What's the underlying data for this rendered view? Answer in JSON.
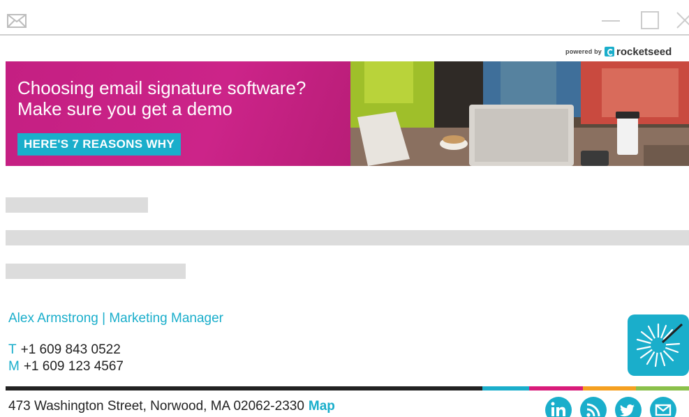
{
  "window": {
    "icons": [
      "mail-icon",
      "minimize-icon",
      "maximize-icon",
      "close-icon"
    ]
  },
  "powered_by": {
    "prefix": "powered by",
    "brand": "rocketseed"
  },
  "banner": {
    "headline_line1": "Choosing email signature software?",
    "headline_line2": "Make sure you get a demo",
    "cta": "HERE'S 7 REASONS WHY",
    "colors": {
      "magenta": "#c81f84",
      "teal": "#1aaecb"
    }
  },
  "signature": {
    "name_title": "Alex Armstrong | Marketing Manager",
    "phone_label": "T",
    "phone": "+1 609 843 0522",
    "mobile_label": "M",
    "mobile": "+1 609 123 4567",
    "address": "473 Washington Street, Norwood, MA 02062-2330",
    "map_link": "Map",
    "color_bar": [
      "#222222",
      "#1aaecb",
      "#d81b7a",
      "#f5a020",
      "#8ac04a"
    ],
    "social_icons": [
      "linkedin-icon",
      "rss-icon",
      "twitter-icon",
      "email-icon"
    ]
  }
}
